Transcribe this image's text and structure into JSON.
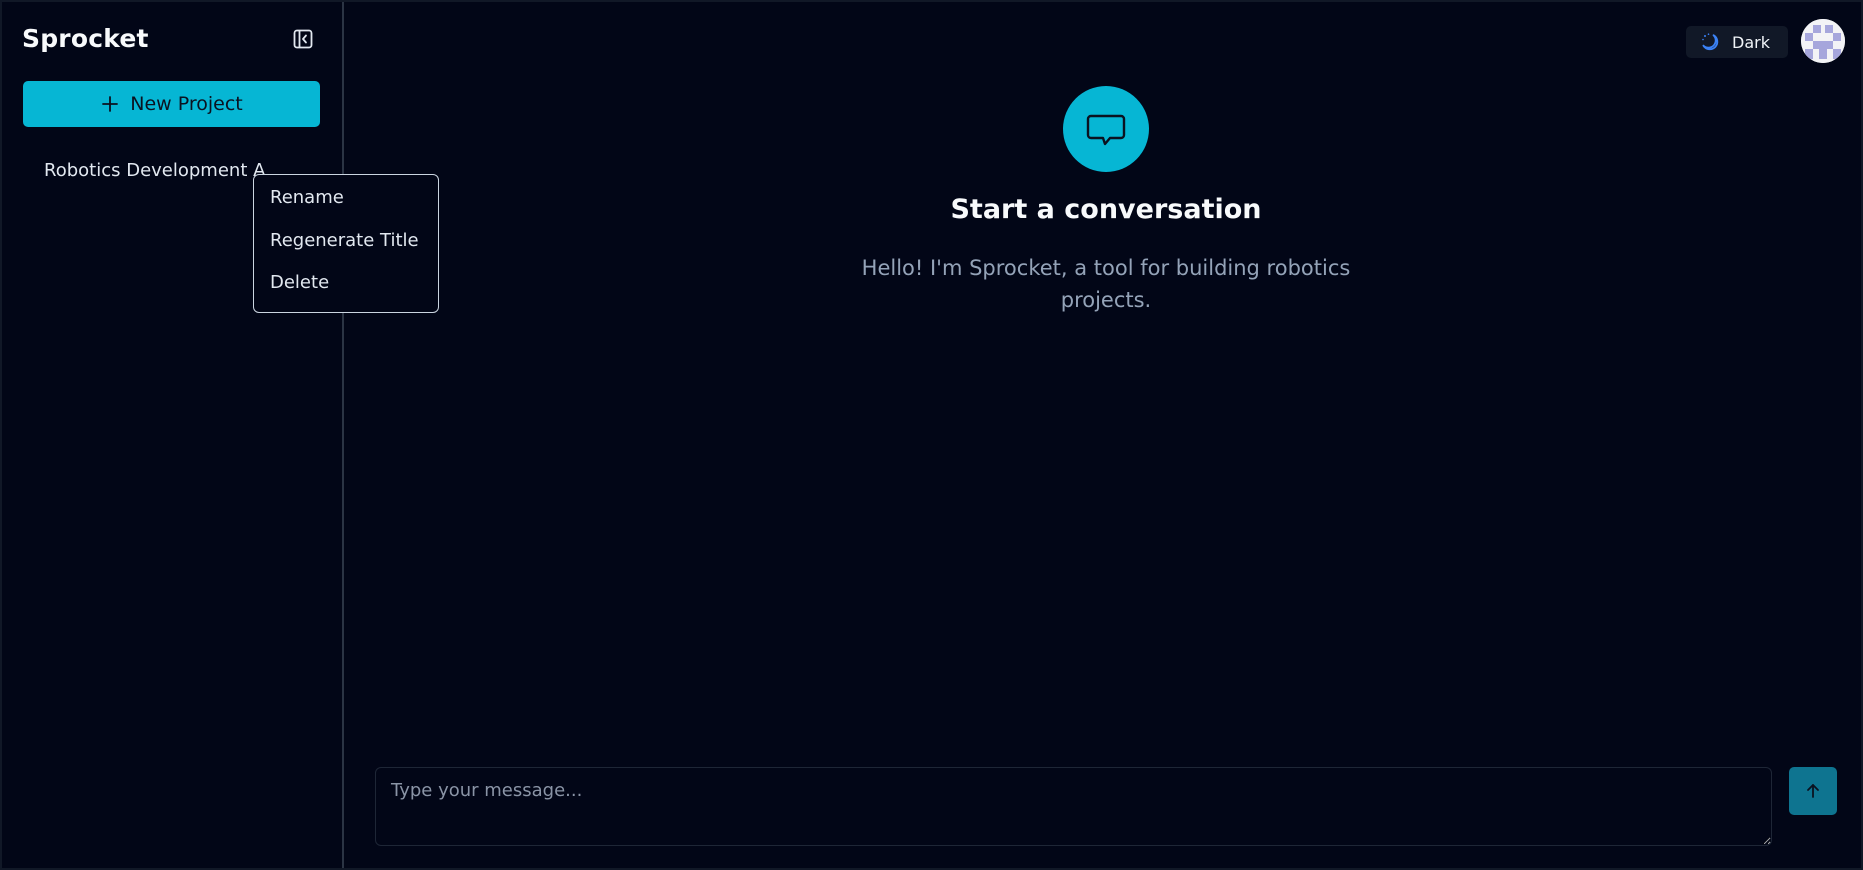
{
  "app": {
    "name": "Sprocket"
  },
  "sidebar": {
    "new_project_label": "New Project",
    "projects": [
      {
        "label": "Robotics Development A"
      }
    ]
  },
  "context_menu": {
    "items": [
      {
        "label": "Rename"
      },
      {
        "label": "Regenerate Title"
      },
      {
        "label": "Delete"
      }
    ]
  },
  "header": {
    "theme_label": "Dark"
  },
  "main": {
    "title": "Start a conversation",
    "subtitle": "Hello! I'm Sprocket, a tool for building robotics projects."
  },
  "composer": {
    "placeholder": "Type your message...",
    "value": ""
  },
  "colors": {
    "accent": "#06b6d4",
    "send_button": "#0e7490",
    "background": "#020617",
    "muted_text": "#94a3b8"
  },
  "icons": {
    "collapse": "sidebar-collapse-icon",
    "plus": "plus-icon",
    "theme": "moon-icon",
    "chat": "chat-bubble-icon",
    "send": "arrow-up-icon"
  }
}
